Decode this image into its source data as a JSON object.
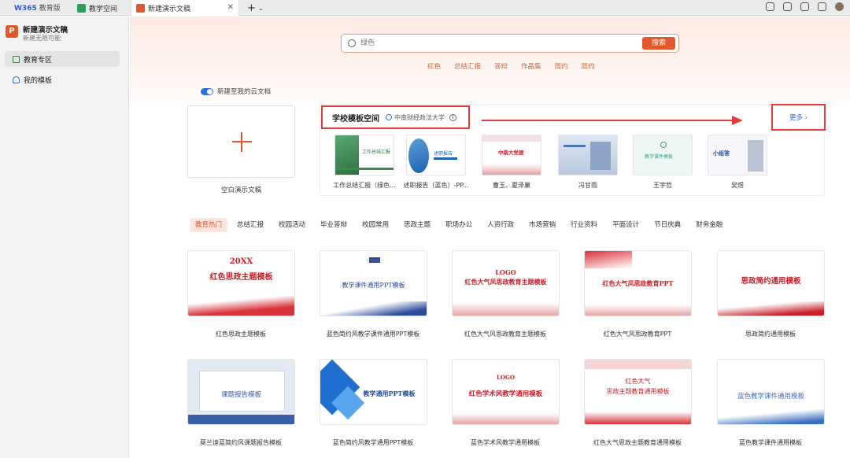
{
  "window": {
    "brand": "W365",
    "brand_suffix": "教育版",
    "tabs": [
      {
        "label": "教学空间",
        "icon": "workspace-icon"
      },
      {
        "label": "新建演示文稿",
        "icon": "presentation-icon"
      }
    ],
    "new_tab": "+"
  },
  "sidebar": {
    "doc_icon_letter": "P",
    "doc_title": "新建演示文稿",
    "doc_sub": "新建无限可能",
    "items": [
      {
        "label": "教育专区",
        "icon": "education-icon"
      },
      {
        "label": "我的模板",
        "icon": "user-icon"
      }
    ]
  },
  "search": {
    "placeholder": "绿色",
    "button": "搜索"
  },
  "tags": [
    "红色",
    "总结汇报",
    "答辩",
    "作品集",
    "简约",
    "简约"
  ],
  "cloud_toggle": "新建至我的云文档",
  "blank": {
    "label": "空白演示文稿"
  },
  "school": {
    "title": "学校模板空间",
    "university": "中南财经政法大学",
    "more": "更多 ›",
    "items": [
      {
        "label": "工作总结汇报（绿色...",
        "thumb_title": "工作总结汇报",
        "accent": "#3d8a4a"
      },
      {
        "label": "述职报告（蓝色）-PP...",
        "thumb_title": "述职报告",
        "accent": "#1f5fb0"
      },
      {
        "label": "曹玉、夏泽巢",
        "thumb_title": "中南大党建",
        "accent": "#c8202a"
      },
      {
        "label": "冯甘雨",
        "thumb_title": "",
        "accent": "#4c78b8"
      },
      {
        "label": "王宇哲",
        "thumb_title": "教学课件模板",
        "accent": "#3f9a8a"
      },
      {
        "label": "吴煜",
        "thumb_title": "小组答",
        "accent": "#1f4e9a"
      }
    ]
  },
  "categories": [
    "教育热门",
    "总结汇报",
    "校园活动",
    "毕业答辩",
    "校园常用",
    "思政主题",
    "职场办公",
    "人资行政",
    "市场营销",
    "行业资料",
    "平面设计",
    "节日庆典",
    "财务金融"
  ],
  "templates": [
    {
      "label": "红色思政主题模板",
      "title": "红色思政主题模板",
      "sub": "20XX",
      "accent": "#c8202a"
    },
    {
      "label": "蓝色简约风教学课件通用PPT模板",
      "title": "教学课件通用PPT模板",
      "sub": "LOGO",
      "accent": "#2a4a9a"
    },
    {
      "label": "红色大气风思政教育主题模板",
      "title": "红色大气风思政教育主题模板",
      "sub": "LOGO",
      "accent": "#c8202a"
    },
    {
      "label": "红色大气风思政教育PPT",
      "title": "红色大气风思政教育PPT",
      "sub": "",
      "accent": "#c8202a"
    },
    {
      "label": "思政简约通用模板",
      "title": "思政简约通用模板",
      "sub": "",
      "accent": "#c8202a"
    },
    {
      "label": "莫兰迪蓝简约风课题报告模板",
      "title": "课题报告模板",
      "sub": "",
      "accent": "#3a5fa8"
    },
    {
      "label": "蓝色简约风教学通用PPT模板",
      "title": "教学通用PPT模板",
      "sub": "",
      "accent": "#1f6fd0"
    },
    {
      "label": "蓝色学术风教学通用模板",
      "title": "红色学术风教学通用模板",
      "sub": "LOGO",
      "accent": "#c8202a"
    },
    {
      "label": "红色大气思政主题教育通用模板",
      "title": "思政主题教育通用模板",
      "sub": "红色大气",
      "accent": "#c8202a"
    },
    {
      "label": "蓝色教学课件通用模板",
      "title": "蓝色教学课件通用模板",
      "sub": "",
      "accent": "#3a6fc0"
    }
  ]
}
